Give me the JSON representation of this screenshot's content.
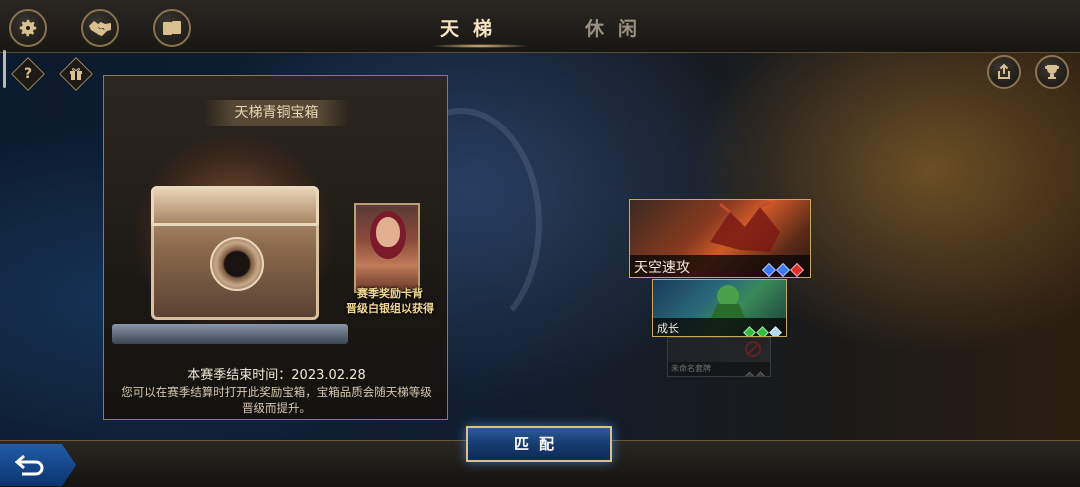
{
  "header": {
    "tabs": [
      {
        "label": "天梯",
        "active": true
      },
      {
        "label": "休闲",
        "active": false
      }
    ],
    "left_icons": [
      "gear-icon",
      "handshake-icon",
      "cards-icon"
    ],
    "sub_icons": [
      {
        "icon": "help-icon",
        "glyph": "?"
      },
      {
        "icon": "gift-icon",
        "glyph": "🎁"
      }
    ],
    "right_icons": [
      "share-icon",
      "trophy-icon"
    ]
  },
  "reward_panel": {
    "title": "天梯青铜宝箱",
    "card_caption_line1": "赛季奖励卡背",
    "card_caption_line2": "晋级白银组以获得",
    "end_time": "本赛季结束时间：2023.02.28",
    "description": "您可以在赛季结算时打开此奖励宝箱，宝箱品质会随天梯等级晋级而提升。"
  },
  "decks": [
    {
      "name": "天空速攻",
      "gems": [
        "#3a7af0",
        "#3a7af0",
        "#e03030"
      ]
    },
    {
      "name": "成长",
      "gems": [
        "#30c040",
        "#30c040",
        "#b0d8f0"
      ]
    },
    {
      "name": "未命名套牌",
      "gems": [
        "#6a6a6a",
        "#6a6a6a"
      ],
      "disabled": true
    }
  ],
  "footer": {
    "match_label": "匹配",
    "back_icon": "back-arrow-icon"
  },
  "colors": {
    "accent_gold": "#c8a860",
    "match_blue": "#173c72"
  }
}
